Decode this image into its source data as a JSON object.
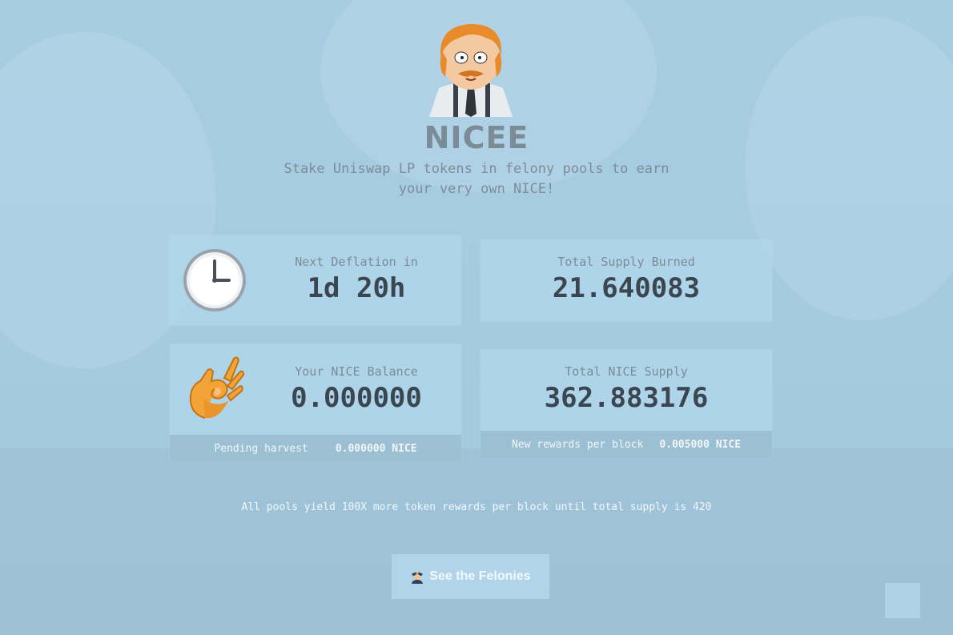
{
  "brand": {
    "name": "NICEE",
    "tagline_line1": "Stake Uniswap LP tokens in felony pools to earn",
    "tagline_line2": "your very own NICE!"
  },
  "stats": {
    "next_deflation": {
      "label": "Next Deflation in",
      "value": "1d 20h",
      "icon": "clock-icon"
    },
    "total_burned": {
      "label": "Total Supply Burned",
      "value": "21.640083"
    },
    "balance": {
      "label": "Your NICE Balance",
      "value": "0.000000",
      "icon": "ok-hand-icon",
      "footer_label": "Pending harvest",
      "footer_value": "0.000000 NICE"
    },
    "total_supply": {
      "label": "Total NICE Supply",
      "value": "362.883176",
      "footer_label": "New rewards per block",
      "footer_value": "0.005000 NICE"
    }
  },
  "note": "All pools yield 100X more token rewards per block until total supply is 420",
  "cta": {
    "label": "See the Felonies",
    "icon": "police-officer-icon"
  },
  "colors": {
    "background": "#a7cde3",
    "card": "#afd6ea",
    "value_text": "#3c4650",
    "muted_text": "#7c8c96"
  }
}
